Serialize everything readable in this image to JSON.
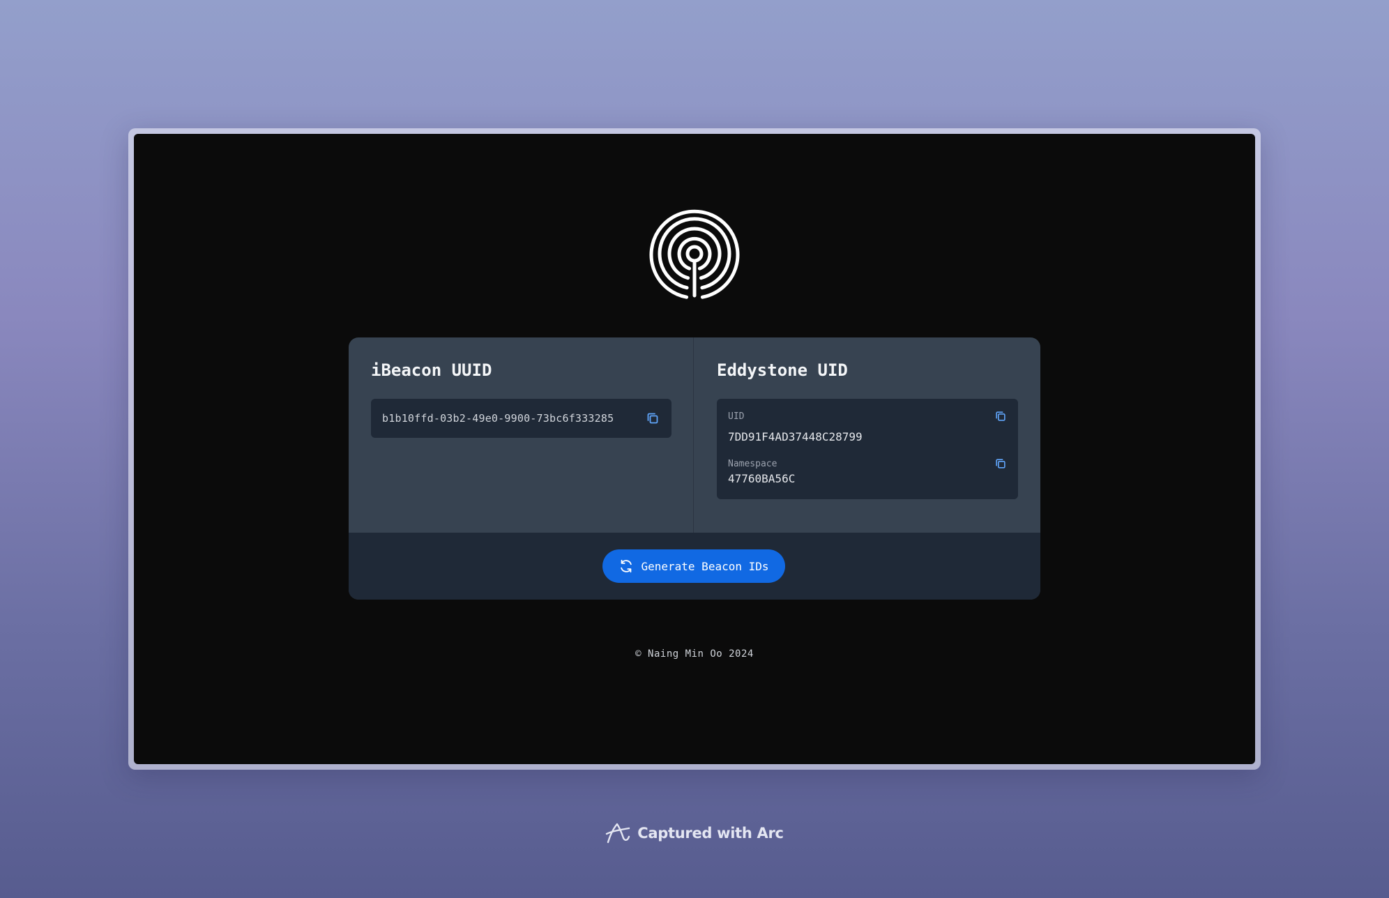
{
  "app": {
    "logo_icon": "beacon-concentric-rings-icon"
  },
  "ibeacon": {
    "title": "iBeacon UUID",
    "uuid": "b1b10ffd-03b2-49e0-9900-73bc6f333285",
    "copy_icon": "copy-icon"
  },
  "eddystone": {
    "title": "Eddystone UID",
    "uid_label": "UID",
    "uid_value": "7DD91F4AD37448C28799",
    "namespace_label": "Namespace",
    "namespace_value": "47760BA56C",
    "copy_icon": "copy-icon"
  },
  "actions": {
    "generate_label": "Generate Beacon IDs",
    "generate_icon": "refresh-icon"
  },
  "footer": {
    "copyright": "© Naing Min Oo 2024"
  },
  "capture_badge": {
    "text": "Captured with Arc",
    "icon": "arc-logo-icon"
  },
  "colors": {
    "page_background": "#0b0b0b",
    "card": "#374351",
    "inset": "#1f2937",
    "accent": "#1169e3",
    "copy_icon": "#60a5fa"
  }
}
